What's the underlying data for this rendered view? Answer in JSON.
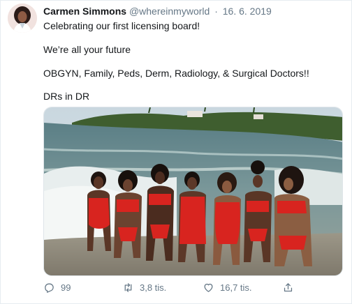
{
  "tweet": {
    "author_name": "Carmen Simmons",
    "handle": "@whereinmyworld",
    "separator": "·",
    "date": "16. 6. 2019",
    "lines": [
      "Celebrating our first licensing board!",
      "We’re all your future",
      "OBGYN, Family, Peds, Derm, Radiology, & Surgical Doctors!!",
      "DRs in DR"
    ]
  },
  "actions": {
    "reply_count": "99",
    "retweet_count": "3,8 tis.",
    "like_count": "16,7 tis."
  },
  "icons": {
    "reply": "reply-icon",
    "retweet": "retweet-icon",
    "like": "heart-icon",
    "share": "share-icon"
  },
  "colors": {
    "text_primary": "#14171a",
    "text_secondary": "#657786",
    "swimsuit_red": "#d8241f"
  }
}
